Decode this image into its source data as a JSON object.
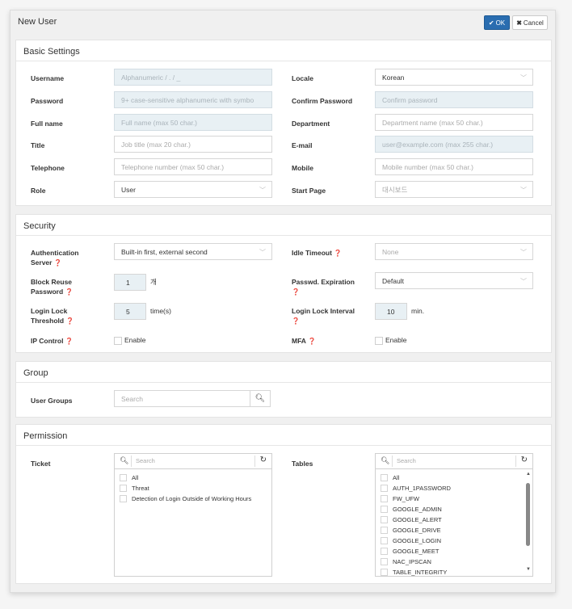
{
  "window": {
    "title": "New User",
    "ok_label": "OK",
    "cancel_label": "Cancel"
  },
  "basic": {
    "heading": "Basic Settings",
    "username": {
      "label": "Username",
      "placeholder": "Alphanumeric / . / _"
    },
    "locale": {
      "label": "Locale",
      "value": "Korean"
    },
    "password": {
      "label": "Password",
      "placeholder": "9+ case-sensitive alphanumeric with symbo"
    },
    "confirm_password": {
      "label": "Confirm Password",
      "placeholder": "Confirm password"
    },
    "full_name": {
      "label": "Full name",
      "placeholder": "Full name (max 50 char.)"
    },
    "department": {
      "label": "Department",
      "placeholder": "Department name (max 50 char.)"
    },
    "title": {
      "label": "Title",
      "placeholder": "Job title (max 20 char.)"
    },
    "email": {
      "label": "E-mail",
      "placeholder": "user@example.com (max 255 char.)"
    },
    "telephone": {
      "label": "Telephone",
      "placeholder": "Telephone number (max 50 char.)"
    },
    "mobile": {
      "label": "Mobile",
      "placeholder": "Mobile number (max 50 char.)"
    },
    "role": {
      "label": "Role",
      "value": "User"
    },
    "start_page": {
      "label": "Start Page",
      "value": "대시보드"
    }
  },
  "security": {
    "heading": "Security",
    "auth_server": {
      "label1": "Authentication",
      "label2": "Server",
      "value": "Built-in first, external second"
    },
    "idle_timeout": {
      "label": "Idle Timeout",
      "value": "None"
    },
    "block_reuse": {
      "label1": "Block Reuse",
      "label2": "Password",
      "value": "1",
      "unit": "개"
    },
    "passwd_expiration": {
      "label1": "Passwd. Expiration",
      "value": "Default"
    },
    "login_lock_threshold": {
      "label1": "Login Lock",
      "label2": "Threshold",
      "value": "5",
      "unit": "time(s)"
    },
    "login_lock_interval": {
      "label1": "Login Lock Interval",
      "value": "10",
      "unit": "min."
    },
    "ip_control": {
      "label": "IP Control",
      "option": "Enable"
    },
    "mfa": {
      "label": "MFA",
      "option": "Enable"
    }
  },
  "group": {
    "heading": "Group",
    "user_groups": {
      "label": "User Groups",
      "placeholder": "Search"
    }
  },
  "permission": {
    "heading": "Permission",
    "ticket": {
      "label": "Ticket",
      "placeholder": "Search",
      "items": [
        "All",
        "Threat",
        "Detection of Login Outside of Working Hours"
      ]
    },
    "tables": {
      "label": "Tables",
      "placeholder": "Search",
      "items": [
        "All",
        "AUTH_1PASSWORD",
        "FW_UFW",
        "GOOGLE_ADMIN",
        "GOOGLE_ALERT",
        "GOOGLE_DRIVE",
        "GOOGLE_LOGIN",
        "GOOGLE_MEET",
        "NAC_IPSCAN",
        "TABLE_INTEGRITY"
      ]
    }
  },
  "icons": {
    "check": "check-icon",
    "close": "close-icon",
    "help": "question-circle-icon",
    "chevron": "chevron-down-icon",
    "search": "search-icon",
    "refresh": "refresh-icon"
  },
  "colors": {
    "primary": "#2a6db0",
    "readonly_field": "#e8f0f4"
  }
}
